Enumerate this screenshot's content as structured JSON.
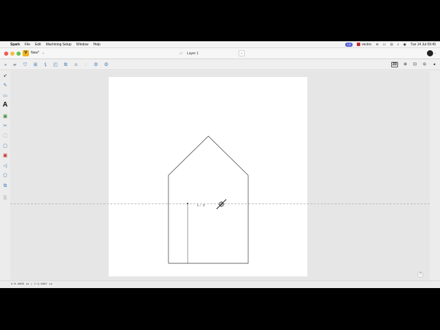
{
  "menubar": {
    "apple_icon": "apple-icon",
    "app_name": "Spark",
    "items": [
      "File",
      "Edit",
      "Machining Setup",
      "Window",
      "Help"
    ],
    "status_pill": "1/8",
    "vectric_label": "vectric",
    "clock": "Tue 14 Jul  09:45"
  },
  "titlebar": {
    "app_logo": "V",
    "document_name": "New*",
    "doc_chevron": "⌄",
    "layer_name": "Layer 1",
    "layer_chevron": "⌄"
  },
  "toolbar": {
    "view_mode": "2D"
  },
  "canvas": {
    "dimension_label": "L: 2",
    "help_label": "?"
  },
  "statusbar": {
    "coordinates": "X:0.6005 in | Y:3.9867 in"
  },
  "colors": {
    "accent": "#4a7fb5",
    "status_pill": "#5561d6",
    "logo": "#f2b31b"
  }
}
